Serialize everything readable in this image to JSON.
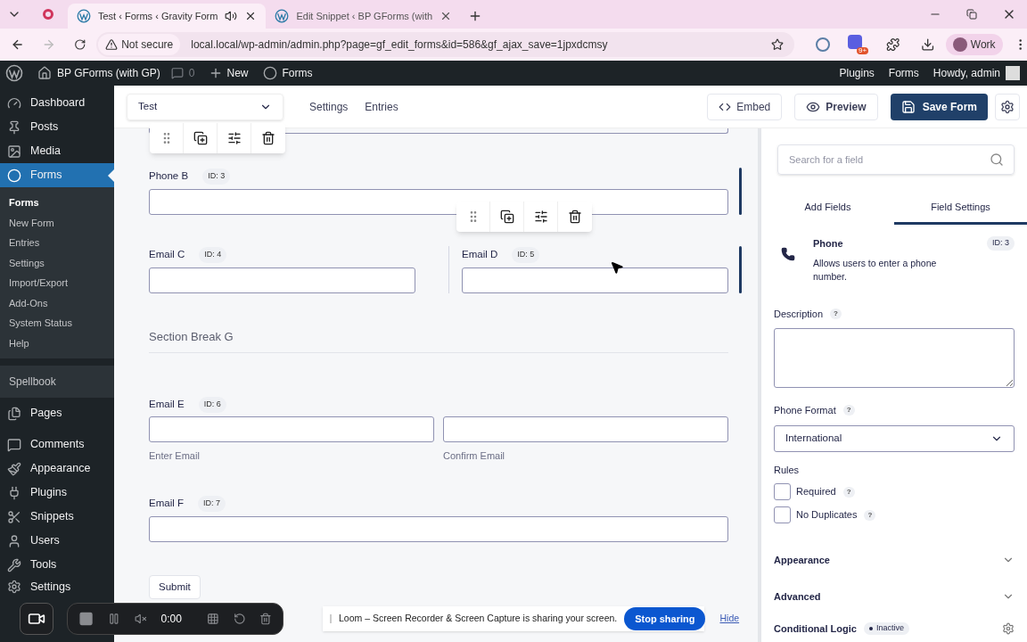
{
  "browser": {
    "tabs": [
      {
        "title": "Test ‹ Forms ‹ Gravity Form",
        "selected": true,
        "audio": true
      },
      {
        "title": "Edit Snippet ‹ BP GForms (with",
        "selected": false,
        "audio": false
      }
    ],
    "address": {
      "security": "Not secure",
      "url": "local.local/wp-admin/admin.php?page=gf_edit_forms&id=586&gf_ajax_save=1jpxdcmsy"
    },
    "extension_badge": "9+",
    "profile": "Work"
  },
  "admin_bar": {
    "site": "BP GForms (with GP)",
    "comments": "0",
    "new": "New",
    "forms": "Forms",
    "right": [
      "Plugins",
      "Forms"
    ],
    "howdy": "Howdy, admin"
  },
  "sidebar": {
    "items": [
      {
        "label": "Dashboard",
        "kind": "menu",
        "selected": false
      },
      {
        "label": "Posts",
        "kind": "menu",
        "selected": false
      },
      {
        "label": "Media",
        "kind": "menu",
        "selected": false
      },
      {
        "label": "Forms",
        "kind": "menu",
        "selected": true,
        "children": [
          {
            "label": "Forms",
            "selected": true
          },
          {
            "label": "New Form",
            "selected": false
          },
          {
            "label": "Entries",
            "selected": false
          },
          {
            "label": "Settings",
            "selected": false
          },
          {
            "label": "Import/Export",
            "selected": false
          },
          {
            "label": "Add-Ons",
            "selected": false
          },
          {
            "label": "System Status",
            "selected": false
          },
          {
            "label": "Help",
            "selected": false
          }
        ]
      },
      {
        "label": "Spellbook",
        "kind": "heading",
        "selected": false
      },
      {
        "label": "Pages",
        "kind": "menu",
        "selected": false
      },
      {
        "label": "Comments",
        "kind": "menu",
        "selected": false
      },
      {
        "label": "Appearance",
        "kind": "menu",
        "selected": false
      },
      {
        "label": "Plugins",
        "kind": "menu",
        "selected": false
      },
      {
        "label": "Snippets",
        "kind": "menu",
        "selected": false
      },
      {
        "label": "Users",
        "kind": "menu",
        "selected": false
      },
      {
        "label": "Tools",
        "kind": "menu",
        "selected": false
      },
      {
        "label": "Settings",
        "kind": "menu",
        "selected": false
      }
    ]
  },
  "editor": {
    "form_select": "Test",
    "links": [
      "Settings",
      "Entries"
    ],
    "embed": "Embed",
    "preview": "Preview",
    "save": "Save Form"
  },
  "canvas": {
    "fields": [
      {
        "kind": "partial",
        "selected": false
      },
      {
        "kind": "input",
        "label": "Phone B",
        "id": "ID: 3",
        "selected": true
      },
      {
        "kind": "pair",
        "columns": [
          {
            "label": "Email C",
            "id": "ID: 4",
            "selected": false
          },
          {
            "label": "Email D",
            "id": "ID: 5",
            "selected": true
          }
        ]
      },
      {
        "kind": "section",
        "label": "Section Break G",
        "selected": false
      },
      {
        "kind": "confirm",
        "label": "Email E",
        "id": "ID: 6",
        "selected": false,
        "sublabels": [
          "Enter Email",
          "Confirm Email"
        ]
      },
      {
        "kind": "input",
        "label": "Email F",
        "id": "ID: 7",
        "selected": false
      }
    ],
    "submit": "Submit"
  },
  "panel": {
    "search": {
      "placeholder": "Search for a field"
    },
    "tabs": [
      {
        "label": "Add Fields",
        "selected": false
      },
      {
        "label": "Field Settings",
        "selected": true
      }
    ],
    "field": {
      "name": "Phone",
      "id": "ID: 3",
      "description": "Allows users to enter a phone number."
    },
    "description_label": "Description",
    "format_label": "Phone Format",
    "format_value": "International",
    "rules_label": "Rules",
    "rules": [
      {
        "label": "Required",
        "checked": false
      },
      {
        "label": "No Duplicates",
        "checked": false
      }
    ],
    "sections": [
      {
        "label": "Appearance",
        "expanded": false
      },
      {
        "label": "Advanced",
        "expanded": false
      }
    ],
    "conditional": {
      "label": "Conditional Logic",
      "status": "Inactive"
    },
    "help_mark": "?"
  },
  "loom": {
    "time": "0:00",
    "message": "Loom – Screen Recorder & Screen Capture is sharing your screen.",
    "stop": "Stop sharing",
    "hide": "Hide"
  }
}
